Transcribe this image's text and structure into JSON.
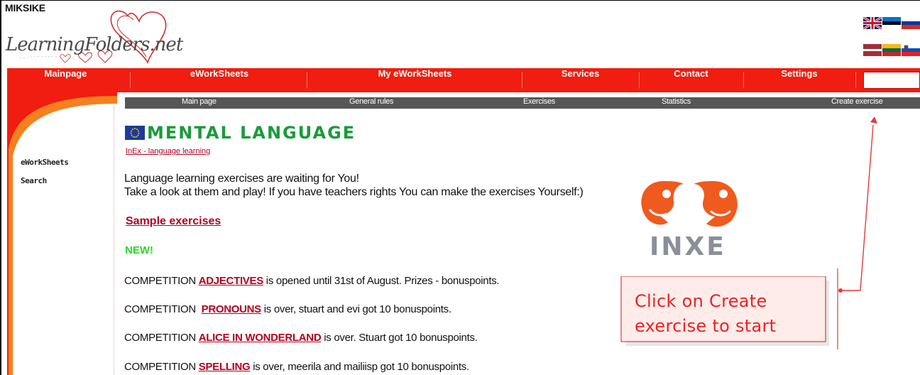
{
  "brand": "MIKSIKE",
  "logo_text": "LearningFolders.net",
  "nav": {
    "items": [
      {
        "label": "Mainpage"
      },
      {
        "label": "eWorkSheets"
      },
      {
        "label": "My eWorkSheets"
      },
      {
        "label": "Services"
      },
      {
        "label": "Contact"
      },
      {
        "label": "Settings"
      }
    ],
    "search_value": ""
  },
  "subnav": {
    "items": [
      {
        "label": "Main page"
      },
      {
        "label": "General rules"
      },
      {
        "label": "Exercises"
      },
      {
        "label": "Statistics"
      },
      {
        "label": "Create exercise"
      }
    ]
  },
  "sidebar": {
    "items": [
      {
        "label": "eWorkSheets"
      },
      {
        "label": "Search"
      }
    ]
  },
  "main": {
    "title": "MENTAL LANGUAGE",
    "subtitle": "InEx - language learning",
    "intro_line1": "Language learning exercises are waiting for You!",
    "intro_line2": "Take a look at them and play! If you have teachers rights You can make the exercises Yourself:)",
    "sample_link": "Sample exercises",
    "new_label": "NEW!",
    "competitions": [
      {
        "prefix": "COMPETITION ",
        "link": "ADJECTIVES",
        "suffix": " is opened until 31st of August. Prizes - bonuspoints."
      },
      {
        "prefix": "COMPETITION  ",
        "link": "PRONOUNS",
        "suffix": " is over, stuart and evi got 10 bonuspoints."
      },
      {
        "prefix": "COMPETITION ",
        "link": "ALICE IN WONDERLAND",
        "suffix": " is over. Stuart got 10 bonuspoints."
      },
      {
        "prefix": "COMPETITION ",
        "link": "SPELLING",
        "suffix": " is over, meerila and mailiisp got 10 bonuspoints."
      }
    ]
  },
  "inxe_logo_text": "INXE",
  "callout": {
    "line1": "Click on Create",
    "line2": "exercise to start"
  },
  "colors": {
    "nav_red": "#f01d10",
    "subnav_gray": "#565656",
    "title_green": "#1a9a3a",
    "link_red": "#b3001e",
    "new_green": "#2ad72a",
    "inxe_orange": "#ef5a1e",
    "inxe_gray": "#8a8f99",
    "callout_red": "#e22"
  }
}
